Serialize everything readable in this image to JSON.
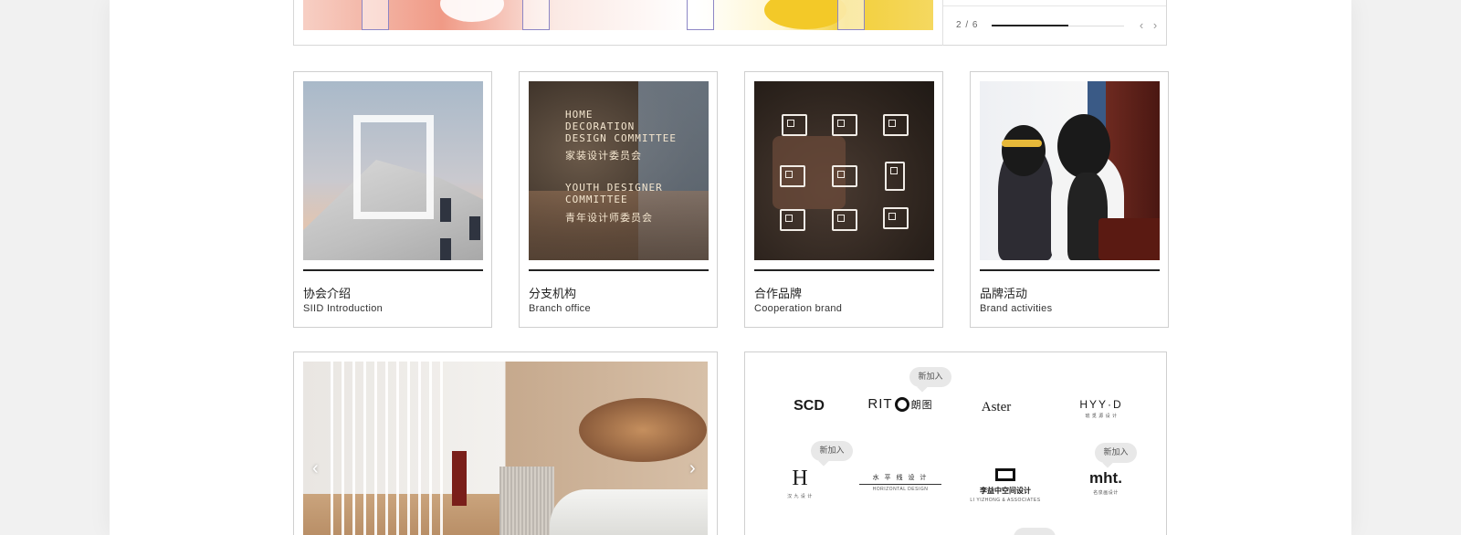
{
  "banner": {
    "slide_counter": "2 / 6",
    "progress": 0.58,
    "prev_icon": "chevron-left-icon",
    "next_icon": "chevron-right-icon"
  },
  "cards": [
    {
      "title_cn": "协会介绍",
      "title_en": "SIID Introduction"
    },
    {
      "title_cn": "分支机构",
      "title_en": "Branch office"
    },
    {
      "title_cn": "合作品牌",
      "title_en": "Cooperation brand"
    },
    {
      "title_cn": "品牌活动",
      "title_en": "Brand activities"
    }
  ],
  "glass_sign": {
    "line1": "HOME",
    "line2": "DECORATION",
    "line3": "DESIGN COMMITTEE",
    "line4": "家装设计委员会",
    "line5": "YOUTH DESIGNER",
    "line6": "COMMITTEE",
    "line7": "青年设计师委员会"
  },
  "interior": {
    "prev_icon": "chevron-left-icon",
    "next_icon": "chevron-right-icon"
  },
  "brands": {
    "new_label": "新加入",
    "items": [
      {
        "main": "SCD"
      },
      {
        "main_left": "RIT",
        "main_right": "朗图"
      },
      {
        "main": "Aster"
      },
      {
        "main": "HYY·D",
        "sub": "琥 觅 源 设 计"
      },
      {
        "main": "H",
        "sub": "汉 九 设 计"
      },
      {
        "main": "水 平 线 设 计",
        "sub": "HORIZONTAL DESIGN"
      },
      {
        "main": "李益中空间设计",
        "sub": "LI YIZHONG & ASSOCIATES"
      },
      {
        "main": "mht.",
        "sub": "名泉画设计"
      }
    ]
  },
  "colors": {
    "accent_line": "#222222",
    "border": "#cfcfcf",
    "badge_bg": "#e8e8e8"
  }
}
